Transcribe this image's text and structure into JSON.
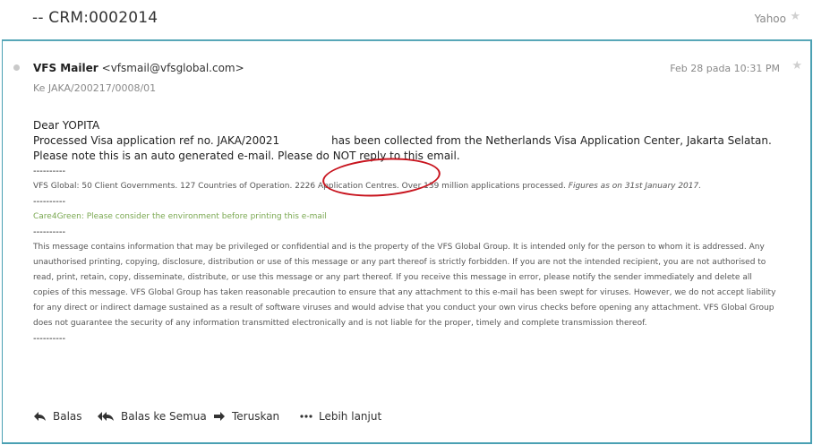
{
  "header": {
    "subject": "-- CRM:0002014",
    "provider": "Yahoo"
  },
  "message": {
    "sender_name": "VFS Mailer",
    "sender_email": "<vfsmail@vfsglobal.com>",
    "date": "Feb 28 pada 10:31 PM",
    "to": "Ke  JAKA/200217/0008/01",
    "greeting": "Dear YOPITA",
    "line1_prefix": "Processed Visa application ref no. JAKA/20021",
    "line1_suffix": "has been collected from the Netherlands Visa Application Center, Jakarta Selatan.",
    "line2": "Please note this is an auto generated e-mail. Please do NOT reply to this email.",
    "separator": "----------",
    "stats": "VFS Global: 50 Client Governments. 127 Countries of Operation. 2226 Application Centres. Over 139 million applications processed.",
    "stats_note": "Figures as on 31st January 2017.",
    "care": "Care4Green: Please consider the environment before printing this e-mail",
    "disclaimer": "This message contains information that may be privileged or confidential and is the property of the VFS Global Group. It is intended only for the person to whom it is addressed. Any unauthorised printing, copying, disclosure, distribution or use of this message or any part thereof is strictly forbidden. If you are not the intended recipient, you are not authorised to read, print, retain, copy, disseminate, distribute, or use this message or any part thereof. If you receive this message in error, please notify the sender immediately and delete all copies of this message. VFS Global Group has taken reasonable precaution to ensure that any attachment to this e-mail has been swept for viruses. However, we do not accept liability for any direct or indirect damage sustained as a result of software viruses and would advise that you conduct your own virus checks before opening any attachment. VFS Global Group does not guarantee the security of any information transmitted electronically and is not liable for the proper, timely and complete transmission thereof."
  },
  "actions": {
    "reply": "Balas",
    "reply_all": "Balas ke Semua",
    "forward": "Teruskan",
    "more": "Lebih lanjut"
  },
  "colors": {
    "border": "#4aa0b3",
    "highlight": "#c8141e",
    "care_green": "#7aa851"
  }
}
